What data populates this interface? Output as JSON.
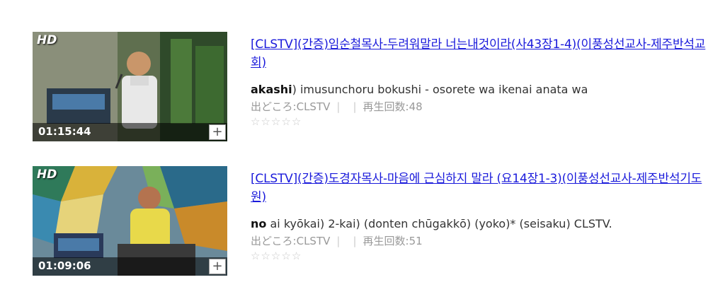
{
  "results": [
    {
      "hd_label": "HD",
      "duration": "01:15:44",
      "add_label": "+",
      "title": "[CLSTV](간증)임순철목사-두려워말라 너는내것이라(사43장1-4)(이풍성선교사-제주반석교회)",
      "desc_bold": "akashi",
      "desc_rest": ") imusunchoru bokushi - osorete wa ikenai anata wa",
      "source_label": "出どころ:CLSTV",
      "sep1": "|",
      "sep2": "|",
      "views_label": "再生回数:48",
      "rating_stars": [
        "☆",
        "☆",
        "☆",
        "☆",
        "☆"
      ]
    },
    {
      "hd_label": "HD",
      "duration": "01:09:06",
      "add_label": "+",
      "title": "[CLSTV](간증)도경자목사-마음에 근심하지 말라 (요14장1-3)(이풍성선교사-제주반석기도원)",
      "desc_bold": "no",
      "desc_rest": " ai kyōkai) 2-kai) (donten chūgakkō) (yoko)* (seisaku) CLSTV.",
      "source_label": "出どころ:CLSTV",
      "sep1": "|",
      "sep2": "|",
      "views_label": "再生回数:51",
      "rating_stars": [
        "☆",
        "☆",
        "☆",
        "☆",
        "☆"
      ]
    }
  ],
  "colors": {
    "link": "#1a1adb",
    "meta": "#999999",
    "star": "#c9c9c9"
  }
}
